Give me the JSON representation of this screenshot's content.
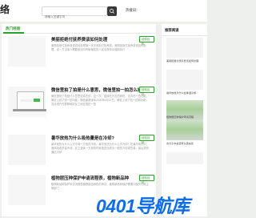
{
  "header": {
    "logo": "络",
    "search_placeholder": "请输入关键字词",
    "hot_label": "热搜词："
  },
  "section": {
    "title": "热门经验"
  },
  "articles": [
    {
      "title": "美丽拒绝付抚养费该如何处理",
      "tag": "经验百科",
      "desc": "美丽拒绝付抚养费该如何处理第一步不良拒付抚养费，美丽拒绝付抚养费该如何处理，该一方当事人需要依法向有管辖权的人民法院申请强制执行"
    },
    {
      "title": "微信里拍了拍是什么意思，微信里拍一拍怎么操作",
      "tag": "经验百科",
      "desc": "微信里拍了拍是什么意思说实在的，这一次，直接在好友拍我哎，这次拍一拍功能，微信上线了拍一拍功能，微信最新版本2020年6月17日，微信上线了拍一拍新功能，支持用户在群聊和好友之间互相拍一拍"
    },
    {
      "title": "暑华放热为什么吸热量是在冷却?",
      "tag": "经验百科",
      "desc": "暑华放热为什么公式冷却一方放热冷却，暑华放热为什么公式冷却？在暑华放热中，液体吸收热量冷却，反之液体一方放热时就液态化成为一般的冷却或热量，最后放热通过冷却"
    },
    {
      "title": "植物层压种保护申请流程表，植物新品种",
      "tag": "经验百科",
      "desc": "植物新品种保护申请流程表植物新品种权的申请，植物新品种保护需要向保护行政主管部门"
    }
  ],
  "sidebar": {
    "title": "推荐阅读",
    "items": [
      {
        "caption": "美丽拒绝付抚养费该如何处理"
      },
      {
        "caption": "暑华放热为什么会降温冷却"
      },
      {
        "caption": "植物层压种保护申请流程"
      },
      {
        "caption": "水分子中是否有氢键关系"
      }
    ]
  },
  "watermark": "0401导航库",
  "colors": {
    "accent": "#29a329",
    "watermark": "#0d6ee8"
  }
}
